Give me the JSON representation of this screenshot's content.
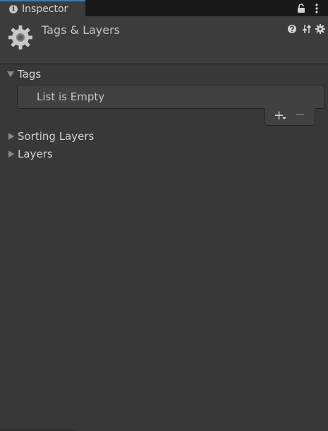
{
  "tab": {
    "label": "Inspector",
    "icon": "info-icon"
  },
  "header": {
    "title": "Tags & Layers",
    "icon": "gear-icon"
  },
  "sections": {
    "tags": {
      "label": "Tags",
      "expanded": true,
      "empty_text": "List is Empty",
      "add_label": "+",
      "remove_label": "−"
    },
    "sorting_layers": {
      "label": "Sorting Layers",
      "expanded": false
    },
    "layers": {
      "label": "Layers",
      "expanded": false
    }
  },
  "colors": {
    "accent": "#3a79bb",
    "background": "#383838",
    "text": "#c4c4c4"
  }
}
